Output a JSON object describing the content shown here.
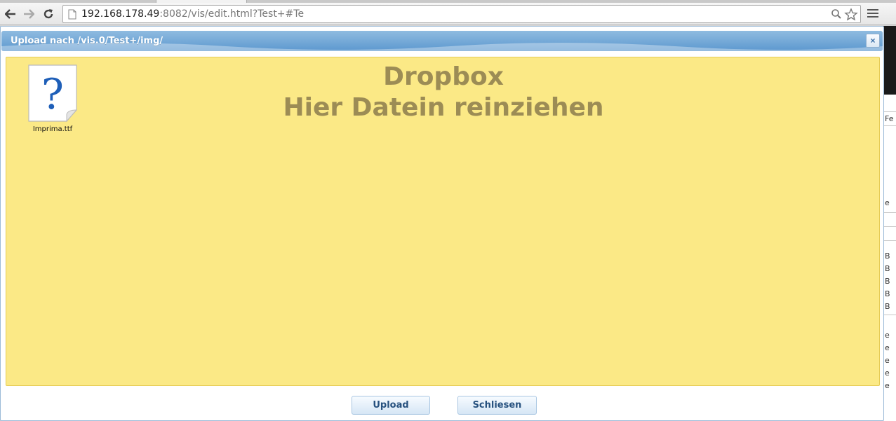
{
  "browser": {
    "url_host": "192.168.178.49",
    "url_rest": ":8082/vis/edit.html?Test+#Te"
  },
  "dialog": {
    "title": "Upload nach /vis.0/Test+/img/",
    "close_label": "×",
    "dropzone": {
      "title_line1": "Dropbox",
      "title_line2": "Hier Datein reinziehen"
    },
    "files": [
      {
        "name": "Imprima.ttf",
        "icon": "unknown-file-icon"
      }
    ],
    "buttons": {
      "upload": "Upload",
      "close": "Schliesen"
    }
  },
  "background_app": {
    "cells": [
      "Fe",
      "e",
      "B",
      "B",
      "B",
      "B",
      "B",
      "e",
      "e",
      "e",
      "e",
      "e"
    ]
  },
  "colors": {
    "dropzone_bg": "#fbe986",
    "dropzone_text": "#9c8c55",
    "titlebar": "#5c98cf",
    "button_text": "#27517f"
  }
}
